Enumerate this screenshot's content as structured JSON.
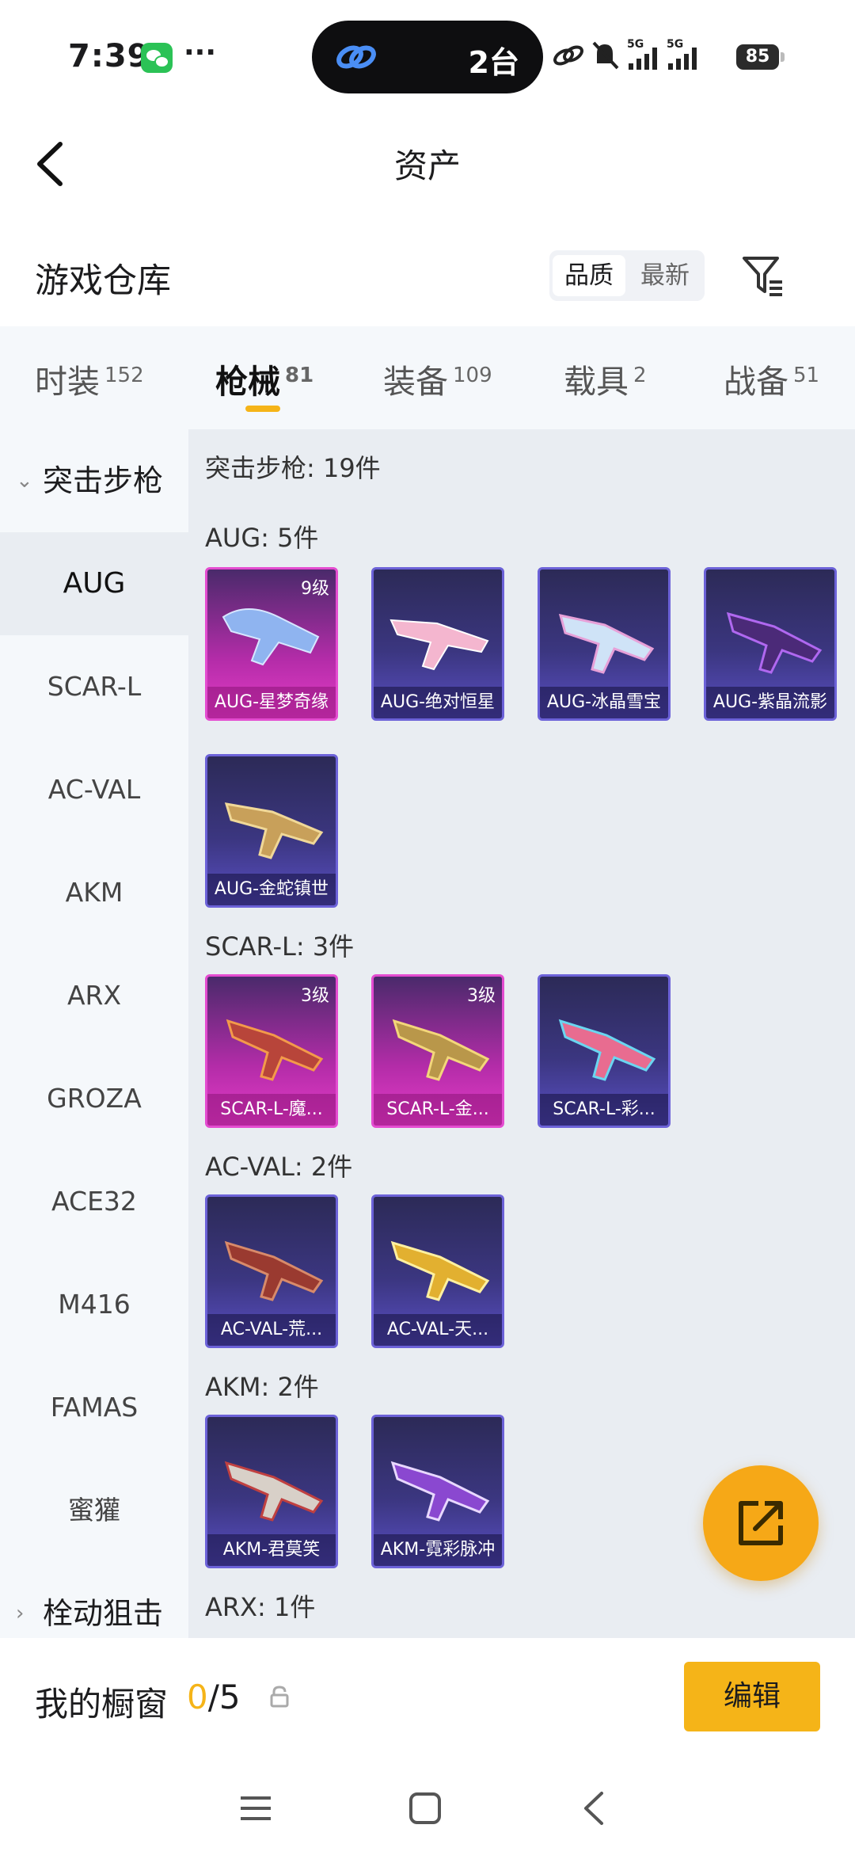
{
  "status_bar": {
    "time": "7:39",
    "dots": "···",
    "island_count": "2台",
    "battery": "85",
    "network": "5G"
  },
  "header": {
    "title": "资产",
    "back_icon": "chevron-left-icon"
  },
  "warehouse": {
    "title": "游戏仓库",
    "sort_options": [
      "品质",
      "最新"
    ],
    "filter_icon": "filter-icon"
  },
  "tabs": [
    {
      "label": "时装",
      "count": "152"
    },
    {
      "label": "枪械",
      "count": "81"
    },
    {
      "label": "装备",
      "count": "109"
    },
    {
      "label": "载具",
      "count": "2"
    },
    {
      "label": "战备",
      "count": "51"
    }
  ],
  "sidebar": {
    "group_open": "突击步枪",
    "items": [
      "AUG",
      "SCAR-L",
      "AC-VAL",
      "AKM",
      "ARX",
      "GROZA",
      "ACE32",
      "M416",
      "FAMAS",
      "蜜獾"
    ],
    "group_closed": "栓动狙击"
  },
  "content": {
    "category_header": "突击步枪: 19件",
    "sections": [
      {
        "header": "AUG: 5件",
        "cards": [
          {
            "name": "AUG-星梦奇缘",
            "level": "9级",
            "rarity": "pink"
          },
          {
            "name": "AUG-绝对恒星",
            "level": "",
            "rarity": "purple"
          },
          {
            "name": "AUG-冰晶雪宝",
            "level": "",
            "rarity": "purple"
          },
          {
            "name": "AUG-紫晶流影",
            "level": "",
            "rarity": "purple"
          },
          {
            "name": "AUG-金蛇镇世",
            "level": "",
            "rarity": "purple"
          }
        ]
      },
      {
        "header": "SCAR-L: 3件",
        "cards": [
          {
            "name": "SCAR-L-魔...",
            "level": "3级",
            "rarity": "pink"
          },
          {
            "name": "SCAR-L-金...",
            "level": "3级",
            "rarity": "pink"
          },
          {
            "name": "SCAR-L-彩...",
            "level": "",
            "rarity": "purple"
          }
        ]
      },
      {
        "header": "AC-VAL: 2件",
        "cards": [
          {
            "name": "AC-VAL-荒...",
            "level": "",
            "rarity": "purple"
          },
          {
            "name": "AC-VAL-天...",
            "level": "",
            "rarity": "purple"
          }
        ]
      },
      {
        "header": "AKM: 2件",
        "cards": [
          {
            "name": "AKM-君莫笑",
            "level": "",
            "rarity": "purple"
          },
          {
            "name": "AKM-霓彩脉冲",
            "level": "",
            "rarity": "purple"
          }
        ]
      },
      {
        "header": "ARX: 1件",
        "cards": []
      }
    ]
  },
  "showcase": {
    "title": "我的橱窗",
    "current": "0",
    "total": "/5",
    "edit_label": "编辑"
  },
  "colors": {
    "accent": "#f5b418",
    "fab": "#f6a817",
    "card_purple": "#3b3680",
    "card_pink": "#e63cc8"
  }
}
